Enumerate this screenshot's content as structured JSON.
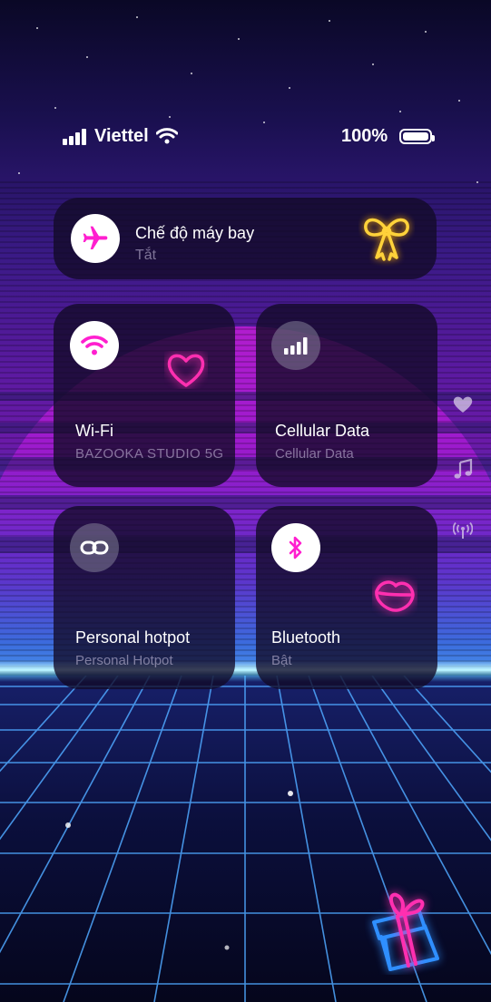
{
  "status_bar": {
    "carrier": "Viettel",
    "battery_percent": "100%",
    "signal_level": 1.0,
    "battery_level": 1.0
  },
  "airplane_mode": {
    "title": "Chế độ máy bay",
    "status": "Tắt",
    "enabled": false,
    "icon": "airplane-icon"
  },
  "tiles": [
    {
      "id": "wifi",
      "title": "Wi-Fi",
      "subtitle": "BAZOOKA STUDIO 5G",
      "active": true,
      "icon": "wifi-icon"
    },
    {
      "id": "cellular",
      "title": "Cellular Data",
      "subtitle": "Cellular Data",
      "active": false,
      "icon": "signal-bars-icon"
    },
    {
      "id": "hotspot",
      "title": "Personal hotpot",
      "subtitle": "Personal Hotpot",
      "active": false,
      "icon": "link-icon"
    },
    {
      "id": "bluetooth",
      "title": "Bluetooth",
      "subtitle": "Bật",
      "active": true,
      "icon": "bluetooth-icon"
    }
  ],
  "side_icons": [
    "heart-icon",
    "music-note-icon",
    "broadcast-icon"
  ],
  "colors": {
    "accent": "#ff1fcf",
    "tile_bg": "#120a26",
    "neon_yellow": "#ffd23a",
    "neon_pink": "#ff2fb0",
    "neon_blue": "#2f8fff"
  }
}
